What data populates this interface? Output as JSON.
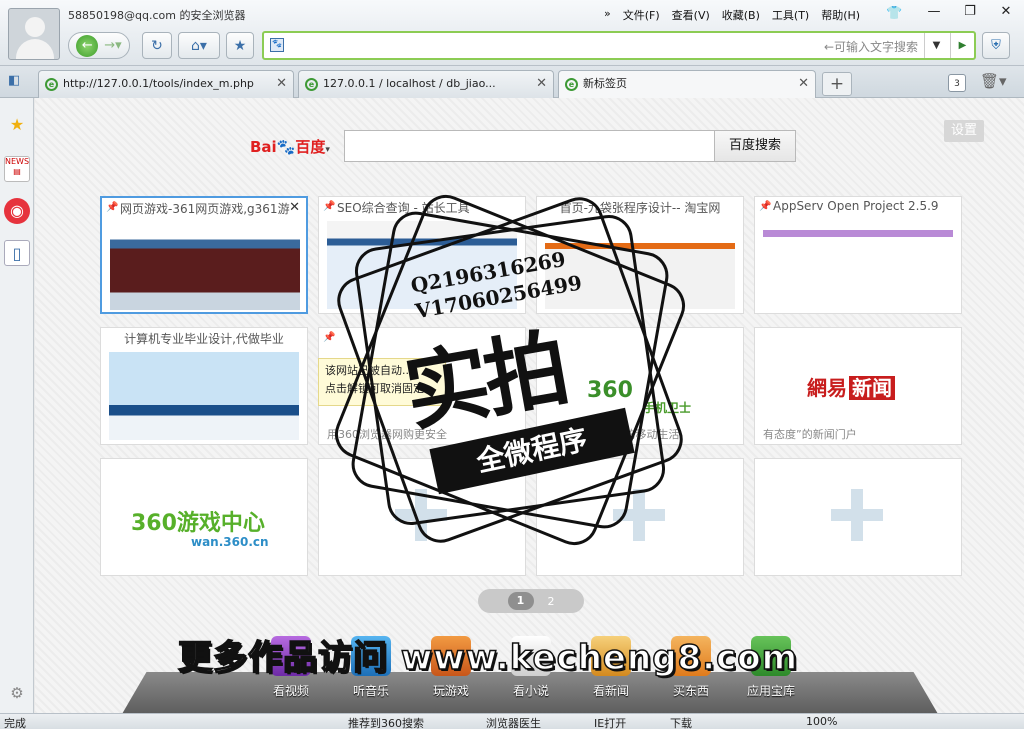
{
  "window": {
    "title": "58850198@qq.com 的安全浏览器",
    "menu": [
      "文件(F)",
      "查看(V)",
      "收藏(B)",
      "工具(T)",
      "帮助(H)"
    ],
    "address": {
      "value": "",
      "hint": "←可输入文字搜索"
    }
  },
  "tabs": [
    {
      "title": "http://127.0.0.1/tools/index_m.php"
    },
    {
      "title": "127.0.0.1 / localhost / db_jiao..."
    },
    {
      "title": "新标签页"
    }
  ],
  "tab_count": "3",
  "search": {
    "logo_brand": "Bai",
    "logo_cn": "百度",
    "button": "百度搜索",
    "settings": "设置"
  },
  "tiles": [
    {
      "caption": "网页游戏-361网页游戏,g361游",
      "pinned": true,
      "active": true
    },
    {
      "caption": "SEO综合查询 - 站长工具",
      "pinned": true
    },
    {
      "caption": "首页-九袋张程序设计-- 淘宝网",
      "pinned": false
    },
    {
      "caption": "AppServ Open Project 2.5.9",
      "pinned": true
    },
    {
      "caption": "计算机专业毕业设计,代做毕业",
      "pinned": false
    },
    {
      "caption": "",
      "bottom_caption": "用360浏览器网购更安全",
      "pinned": true
    },
    {
      "caption": "",
      "bottom_caption": "360手机卫士 您的移动生活",
      "logo_text": "360",
      "logo_sub": "手机卫士"
    },
    {
      "caption": "",
      "bottom_caption": "有态度”的新闻门户",
      "logo_text": "網易",
      "logo_sub": "新闻"
    },
    {
      "caption": "",
      "logo_text": "360游戏中心",
      "logo_sub": "wan.360.cn"
    },
    {
      "caption": ""
    },
    {
      "caption": ""
    },
    {
      "caption": ""
    }
  ],
  "tooltip": {
    "line1": "该网站已被自动...",
    "line2": "点击解锁可取消固定"
  },
  "pager": {
    "pages": [
      "1",
      "2"
    ],
    "current": "1"
  },
  "dock": [
    "看视频",
    "听音乐",
    "玩游戏",
    "看小说",
    "看新闻",
    "买东西",
    "应用宝库"
  ],
  "watermark": {
    "banner": "更多作品访问 www.kecheng8.com",
    "qq": "Q2196316269",
    "v": "V17060256499",
    "main": "实拍",
    "band": "全微程序"
  },
  "statusbar": {
    "left": "完成",
    "items": [
      "推荐到360搜索",
      "浏览器医生",
      "IE打开",
      "下载"
    ],
    "zoom": "100%"
  }
}
